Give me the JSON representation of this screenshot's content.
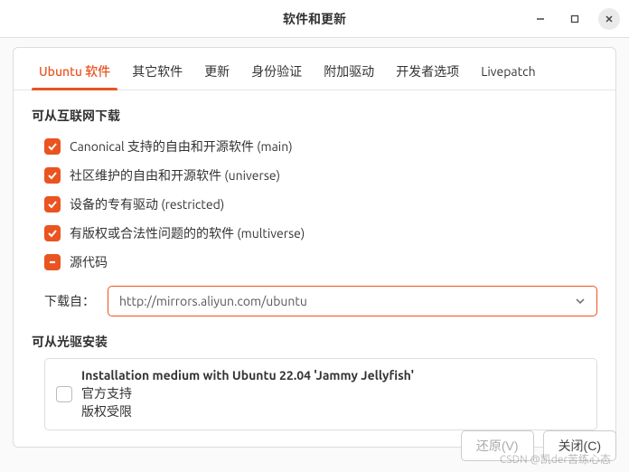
{
  "titlebar": {
    "title": "软件和更新"
  },
  "tabs": [
    {
      "label": "Ubuntu 软件",
      "active": true
    },
    {
      "label": "其它软件"
    },
    {
      "label": "更新"
    },
    {
      "label": "身份验证"
    },
    {
      "label": "附加驱动"
    },
    {
      "label": "开发者选项"
    },
    {
      "label": "Livepatch"
    }
  ],
  "internet_section": {
    "title": "可从互联网下载",
    "items": [
      {
        "label": "Canonical 支持的自由和开源软件 (main)",
        "state": "checked"
      },
      {
        "label": "社区维护的自由和开源软件 (universe)",
        "state": "checked"
      },
      {
        "label": "设备的专有驱动 (restricted)",
        "state": "checked"
      },
      {
        "label": "有版权或合法性问题的的软件 (multiverse)",
        "state": "checked"
      },
      {
        "label": "源代码",
        "state": "indeterminate"
      }
    ],
    "download_label": "下载自：",
    "download_value": "http://mirrors.aliyun.com/ubuntu"
  },
  "cdrom_section": {
    "title": "可从光驱安装",
    "medium_title": "Installation medium with Ubuntu 22.04 'Jammy Jellyfish'",
    "line1": "官方支持",
    "line2": "版权受限"
  },
  "footer": {
    "revert": "还原(V)",
    "close": "关闭(C)"
  },
  "watermark": "CSDN @凯der苦练心态"
}
